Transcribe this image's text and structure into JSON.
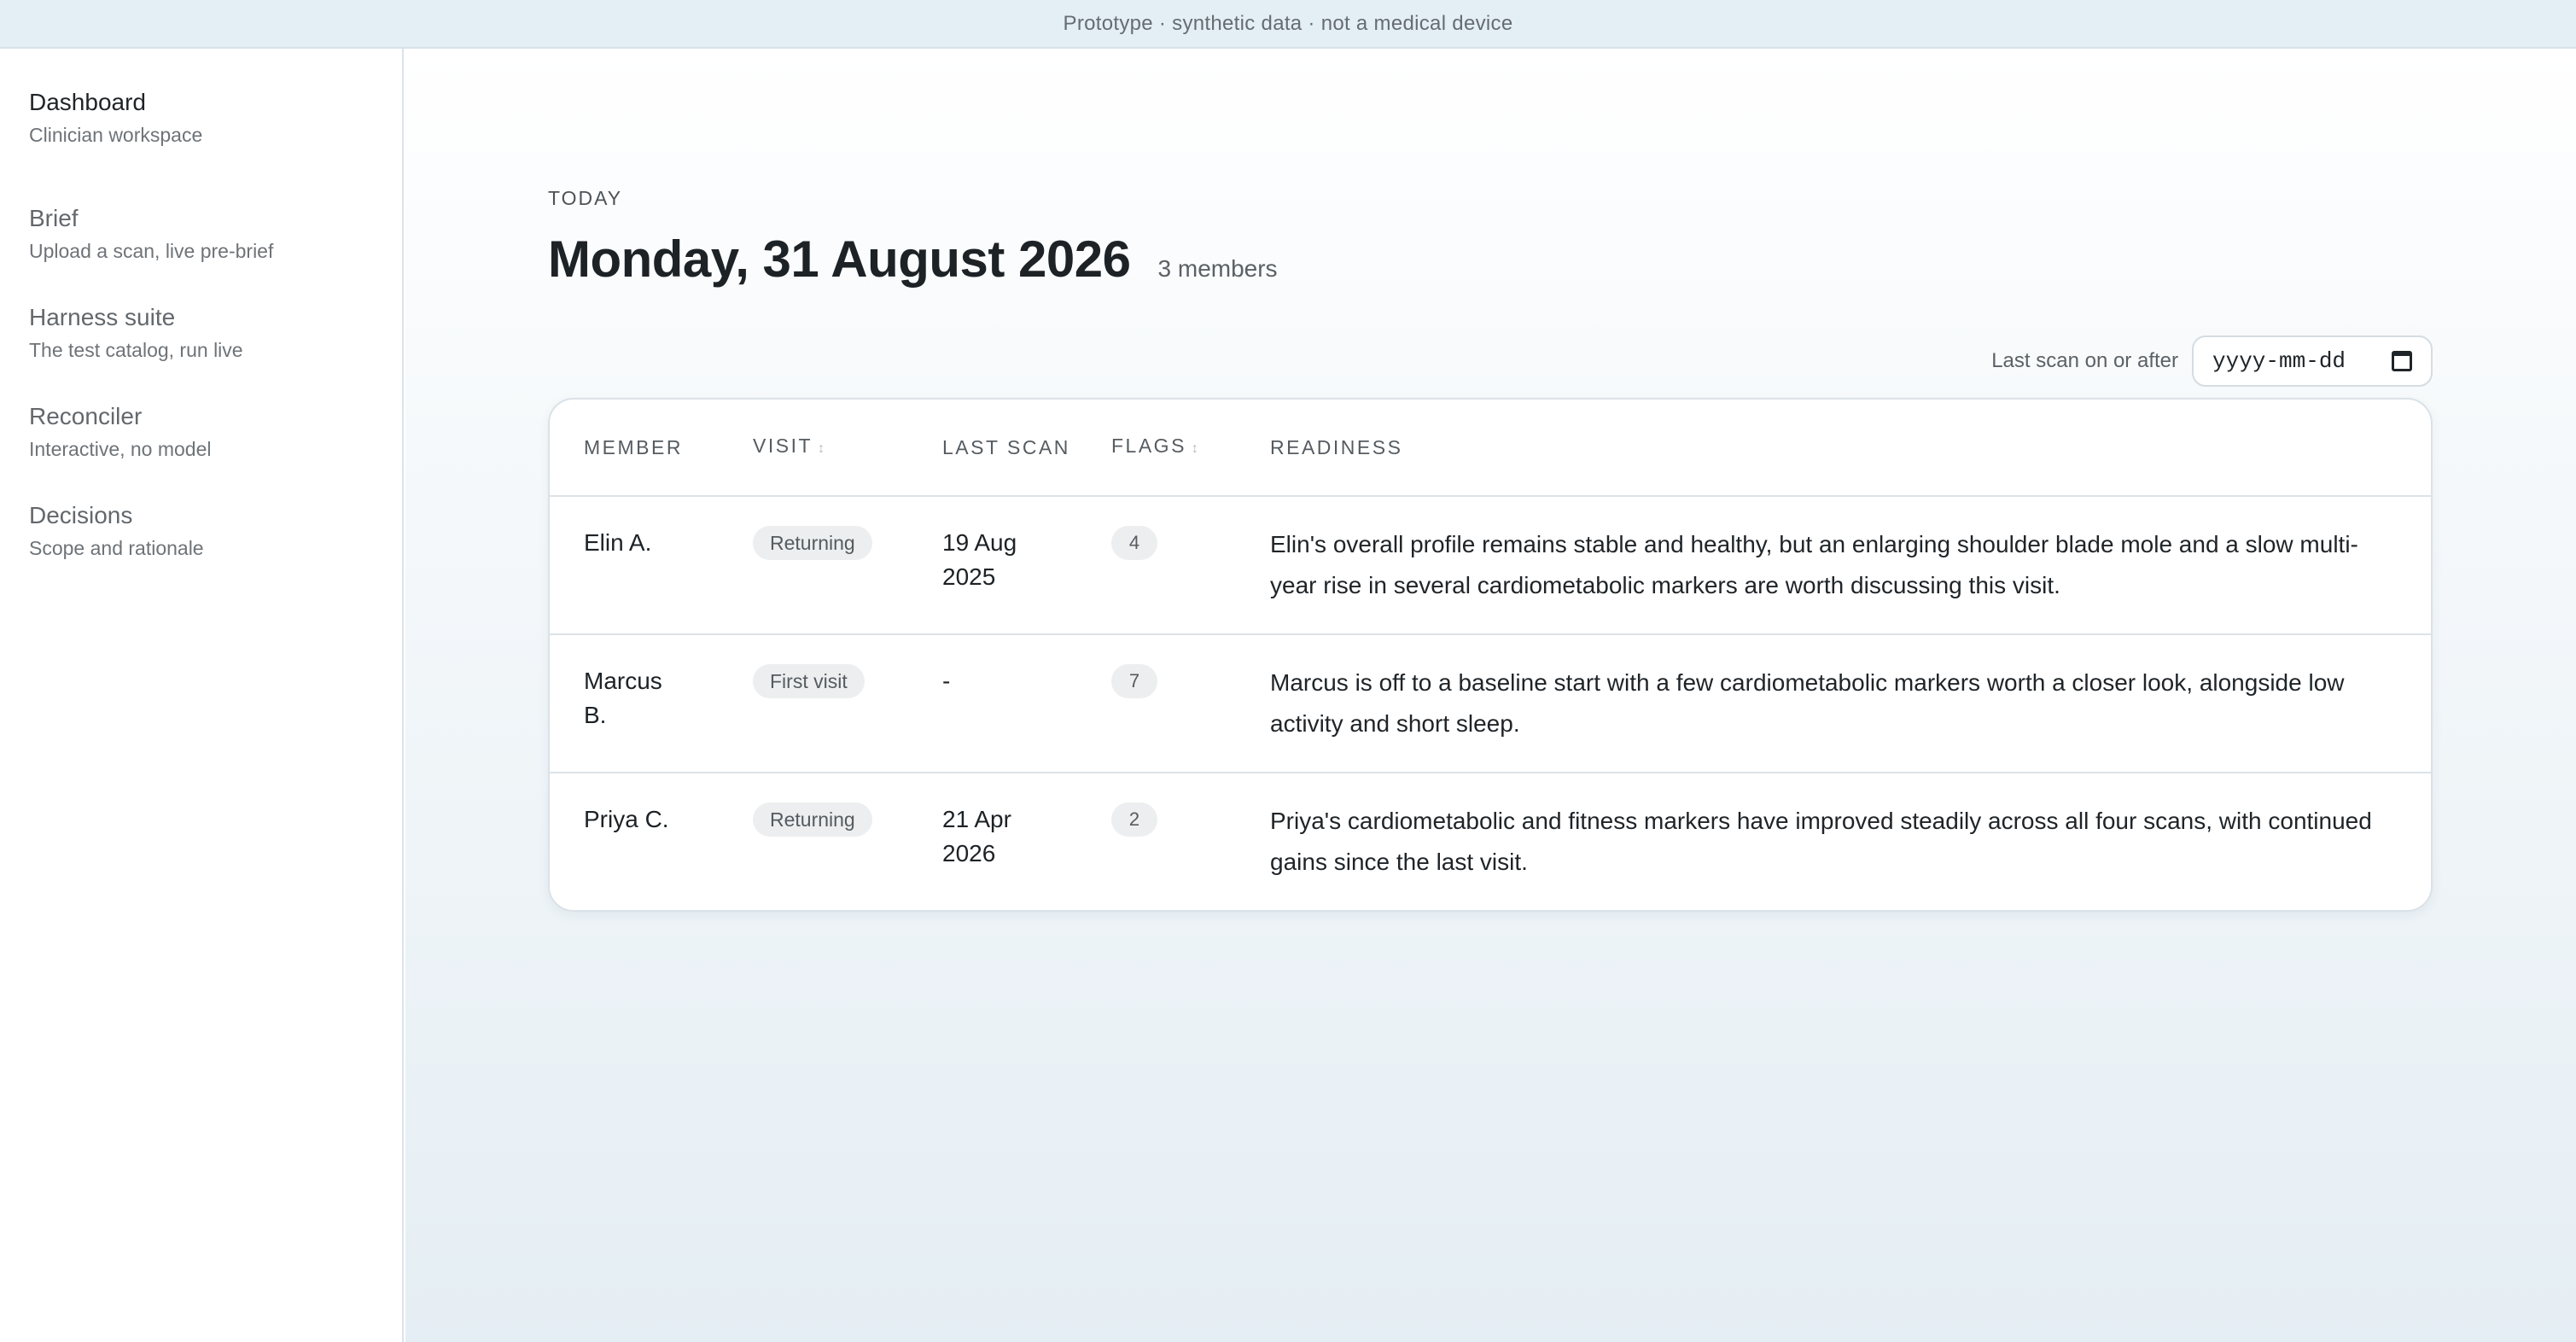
{
  "banner": {
    "text": "Prototype · synthetic data · not a medical device"
  },
  "sidebar": {
    "items": [
      {
        "title": "Dashboard",
        "subtitle": "Clinician workspace",
        "active": true
      },
      {
        "title": "Brief",
        "subtitle": "Upload a scan, live pre-brief"
      },
      {
        "title": "Harness suite",
        "subtitle": "The test catalog, run live"
      },
      {
        "title": "Reconciler",
        "subtitle": "Interactive, no model"
      },
      {
        "title": "Decisions",
        "subtitle": "Scope and rationale"
      }
    ]
  },
  "main": {
    "eyebrow": "TODAY",
    "title": "Monday, 31 August 2026",
    "member_count": "3 members",
    "filter": {
      "label": "Last scan on or after",
      "placeholder": "yyyy-mm-dd"
    }
  },
  "table": {
    "headers": {
      "member": "MEMBER",
      "visit": "VISIT",
      "last_scan": "LAST SCAN",
      "flags": "FLAGS",
      "readiness": "READINESS"
    },
    "rows": [
      {
        "member": "Elin A.",
        "visit": "Returning",
        "last_scan": "19 Aug 2025",
        "flags": "4",
        "readiness": "Elin's overall profile remains stable and healthy, but an enlarging shoulder blade mole and a slow multi-year rise in several cardiometabolic markers are worth discussing this visit."
      },
      {
        "member": "Marcus B.",
        "visit": "First visit",
        "last_scan": "-",
        "flags": "7",
        "readiness": "Marcus is off to a baseline start with a few cardiometabolic markers worth a closer look, alongside low activity and short sleep."
      },
      {
        "member": "Priya C.",
        "visit": "Returning",
        "last_scan": "21 Apr 2026",
        "flags": "2",
        "readiness": "Priya's cardiometabolic and fitness markers have improved steadily across all four scans, with continued gains since the last visit."
      }
    ]
  }
}
